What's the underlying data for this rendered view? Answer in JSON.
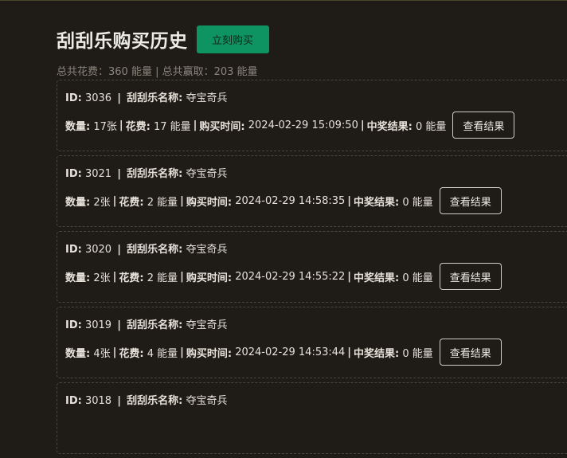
{
  "header": {
    "title": "刮刮乐购买历史",
    "buy_button": "立刻购买"
  },
  "summary": "总共花费：360 能量 | 总共赢取：203 能量",
  "labels": {
    "id": "ID:",
    "name": "刮刮乐名称:",
    "qty": "数量:",
    "cost": "花费:",
    "time": "购买时间:",
    "result": "中奖结果:",
    "sep": "|",
    "view_button": "查看结果"
  },
  "records": [
    {
      "id": "3036",
      "name": "夺宝奇兵",
      "qty": "17张",
      "cost": "17 能量",
      "time": "2024-02-29 15:09:50",
      "result": "0 能量"
    },
    {
      "id": "3021",
      "name": "夺宝奇兵",
      "qty": "2张",
      "cost": "2 能量",
      "time": "2024-02-29 14:58:35",
      "result": "0 能量"
    },
    {
      "id": "3020",
      "name": "夺宝奇兵",
      "qty": "2张",
      "cost": "2 能量",
      "time": "2024-02-29 14:55:22",
      "result": "0 能量"
    },
    {
      "id": "3019",
      "name": "夺宝奇兵",
      "qty": "4张",
      "cost": "4 能量",
      "time": "2024-02-29 14:53:44",
      "result": "0 能量"
    },
    {
      "id": "3018",
      "name": "夺宝奇兵",
      "qty": "",
      "cost": "",
      "time": "",
      "result": ""
    }
  ]
}
